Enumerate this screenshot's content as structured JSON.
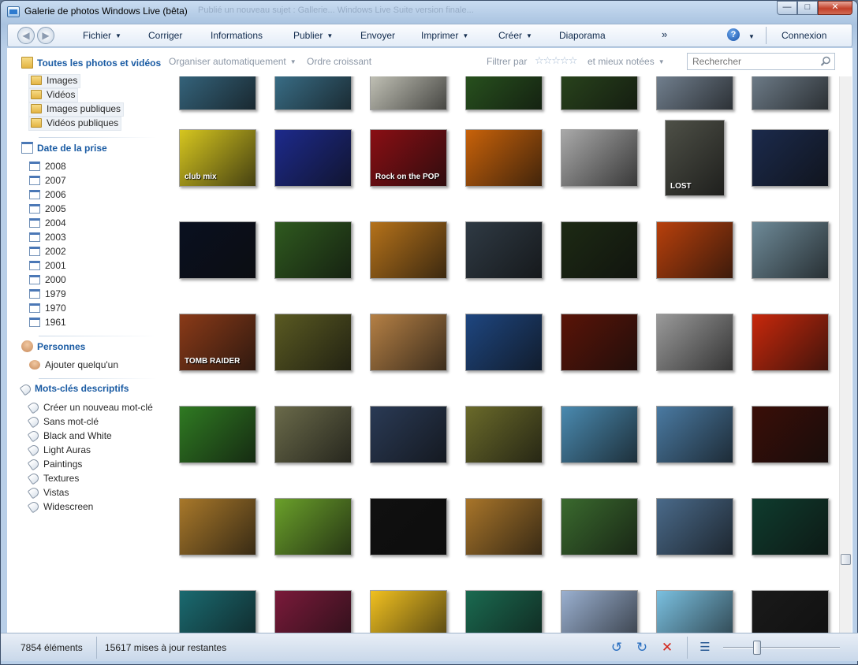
{
  "window": {
    "title": "Galerie de photos Windows Live (bêta)",
    "background_tabs": "Publié un nouveau sujet : Gallerie...    Windows Live Suite version finale...",
    "buttons": {
      "minimize": "—",
      "maximize": "□",
      "close": "✕"
    }
  },
  "menubar": {
    "back_glyph": "◀",
    "forward_glyph": "▶",
    "items": [
      "Fichier",
      "Corriger",
      "Informations",
      "Publier",
      "Envoyer",
      "Imprimer",
      "Créer",
      "Diaporama"
    ],
    "dropdown_caret": "▼",
    "overflow": "»",
    "help": "?",
    "signin": "Connexion"
  },
  "toolbar": {
    "organize": "Organiser automatiquement",
    "order": "Ordre croissant",
    "filter": "Filtrer par",
    "stars": "☆☆☆☆☆",
    "rated": "et mieux notées",
    "search_placeholder": "Rechercher"
  },
  "sidebar": {
    "library": {
      "header": "Toutes les photos et vidéos",
      "items": [
        "Images",
        "Vidéos",
        "Images publiques",
        "Vidéos publiques"
      ]
    },
    "dates": {
      "header": "Date de la prise",
      "items": [
        "2008",
        "2007",
        "2006",
        "2005",
        "2004",
        "2003",
        "2002",
        "2001",
        "2000",
        "1979",
        "1970",
        "1961"
      ]
    },
    "people": {
      "header": "Personnes",
      "add": "Ajouter quelqu'un"
    },
    "tags": {
      "header": "Mots-clés descriptifs",
      "items": [
        "Créer un nouveau mot-clé",
        "Sans mot-clé",
        "Black and White",
        "Light Auras",
        "Paintings",
        "Textures",
        "Vistas",
        "Widescreen"
      ]
    }
  },
  "gallery": {
    "thumbnail_texts": [
      "club mix",
      "Rock on the POP",
      "LOST",
      "TOMB RAIDER"
    ],
    "colors": [
      [
        "#3a6f8a",
        "#3f7a96",
        "#d9d9cc",
        "#2b5a20",
        "#2c4a1e",
        "#7f8fa0",
        "#7a8a98"
      ],
      [
        "#d6c61f",
        "#1d2a8c",
        "#8a0e14",
        "#c8620a",
        "#a9a9a9",
        "#4e5047",
        "#1b2a4c"
      ],
      [
        "#0a1020",
        "#2f5a1f",
        "#b5721a",
        "#2f3a44",
        "#1d2a14",
        "#b8400c",
        "#6e8a98"
      ],
      [
        "#8a3a18",
        "#5a5a22",
        "#b58045",
        "#1e4680",
        "#5a1408",
        "#9a9a9a",
        "#c8280c"
      ],
      [
        "#2f7a22",
        "#6a6a4a",
        "#2a3a55",
        "#6a6a2a",
        "#4a8ab0",
        "#4a7aa2",
        "#3a0e08"
      ],
      [
        "#a8782a",
        "#6aa02a",
        "#101010",
        "#a8752a",
        "#3a6a2e",
        "#4a6a8a",
        "#0f3c2e"
      ],
      [
        "#1a6a70",
        "#7a1a3a",
        "#f0c020",
        "#1a6a50",
        "#9ab0d0",
        "#7ac0e0",
        "#1a1a1a"
      ]
    ]
  },
  "statusbar": {
    "count": "7854 éléments",
    "updates": "15617 mises à jour restantes",
    "rotate_left": "↺",
    "rotate_right": "↻",
    "delete": "✕",
    "details": "☰"
  }
}
